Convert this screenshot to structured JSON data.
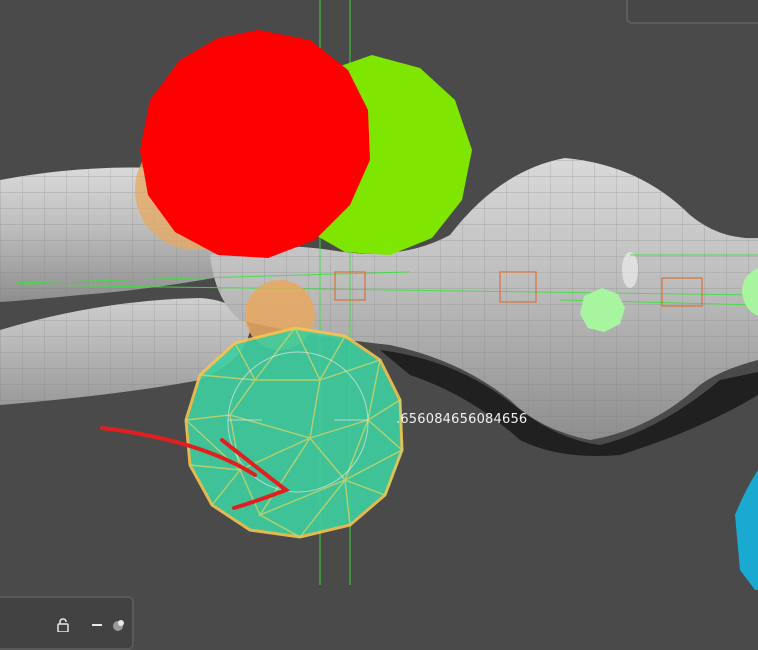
{
  "viewport": {
    "measurement_readout": ".656084656084656"
  },
  "colors": {
    "background": "#4a4a4a",
    "red_sphere": "#ff0000",
    "green_sphere": "#7ee600",
    "selected_sphere_fill": "#3ecfa0",
    "selected_outline": "#f5c451",
    "orange_sphere": "#e8a860",
    "light_green_marker": "#a8f5a0",
    "cyan_object": "#1aa9d0",
    "guide_line": "#3ee03e",
    "bone_box": "#d8733a",
    "annotation_stroke": "#e02020"
  },
  "toolbar": {
    "icons": [
      "lock-icon",
      "minus-icon",
      "sphere-icon"
    ]
  }
}
